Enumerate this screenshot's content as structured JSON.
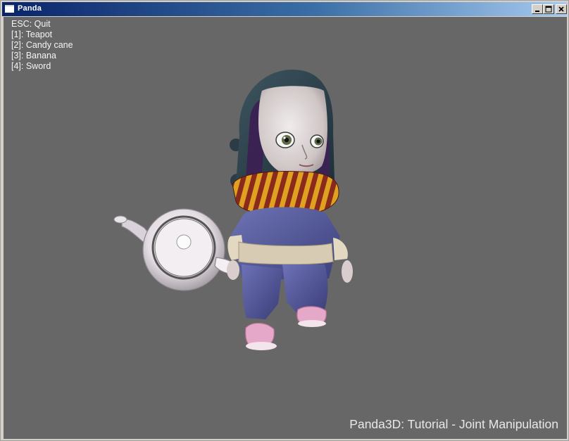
{
  "window": {
    "title": "Panda",
    "controls": {
      "minimize_icon": "minimize-icon",
      "maximize_icon": "maximize-icon",
      "close_icon": "close-icon"
    }
  },
  "viewport": {
    "background": "#676767",
    "instructions": [
      "ESC: Quit",
      "[1]: Teapot",
      "[2]: Candy cane",
      "[3]: Banana",
      "[4]: Sword"
    ],
    "caption": "Panda3D: Tutorial - Joint Manipulation"
  }
}
